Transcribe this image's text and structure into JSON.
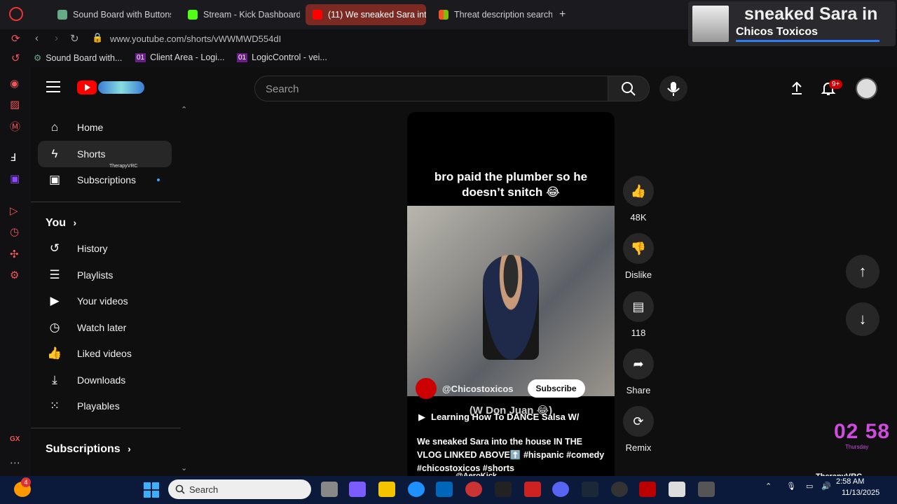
{
  "browser": {
    "tabs": [
      {
        "label": "Sound Board with Buttons"
      },
      {
        "label": "Stream - Kick Dashboard"
      },
      {
        "label": "(11) We sneaked Sara into"
      },
      {
        "label": "Threat description search"
      }
    ],
    "url": "www.youtube.com/shorts/vWWMWD554dI",
    "bookmarks": [
      {
        "label": "Sound Board with..."
      },
      {
        "label": "Client Area - Logi...",
        "badge": "01"
      },
      {
        "label": "LogicControl - vei...",
        "badge": "01"
      }
    ]
  },
  "mini_player": {
    "title": "sneaked Sara in",
    "channel": "Chicos Toxicos"
  },
  "youtube": {
    "search_placeholder": "Search",
    "notif_count": "9+",
    "sidebar": {
      "main": [
        {
          "label": "Home",
          "icon": "home-icon"
        },
        {
          "label": "Shorts",
          "icon": "shorts-icon"
        },
        {
          "label": "Subscriptions",
          "icon": "subscriptions-icon"
        }
      ],
      "shorts_overlay": "TherapyVRC",
      "you_title": "You",
      "you": [
        {
          "label": "History",
          "icon": "history-icon"
        },
        {
          "label": "Playlists",
          "icon": "playlists-icon"
        },
        {
          "label": "Your videos",
          "icon": "your-videos-icon"
        },
        {
          "label": "Watch later",
          "icon": "watch-later-icon"
        },
        {
          "label": "Liked videos",
          "icon": "like-icon"
        },
        {
          "label": "Downloads",
          "icon": "download-icon"
        },
        {
          "label": "Playables",
          "icon": "playables-icon"
        }
      ],
      "subs_title": "Subscriptions"
    },
    "short": {
      "caption_line1": "bro paid the plumber so he",
      "caption_line2": "doesn’t snitch 😂",
      "channel": "@Chicostoxicos",
      "subscribe": "Subscribe",
      "overtext": "(W Don Juan 😂)",
      "suggestion": "Learning How To DANCE Salsa W/",
      "description_plain": "We sneaked Sara into the house IN THE VLOG LINKED ABOVE⬆️",
      "description_tags": "#hispanic #comedy #chicostoxicos #shorts"
    },
    "actions": {
      "like_count": "48K",
      "dislike": "Dislike",
      "comments_count": "118",
      "share": "Share",
      "remix": "Remix"
    }
  },
  "overlay": {
    "clock": "02 58",
    "clock_sub": "Thursday",
    "streamer": "@AeroKick",
    "vrc_name": "TherapyVRC"
  },
  "taskbar": {
    "search_placeholder": "Search",
    "time": "2:58 AM",
    "date": "11/13/2025",
    "badge": "4"
  }
}
